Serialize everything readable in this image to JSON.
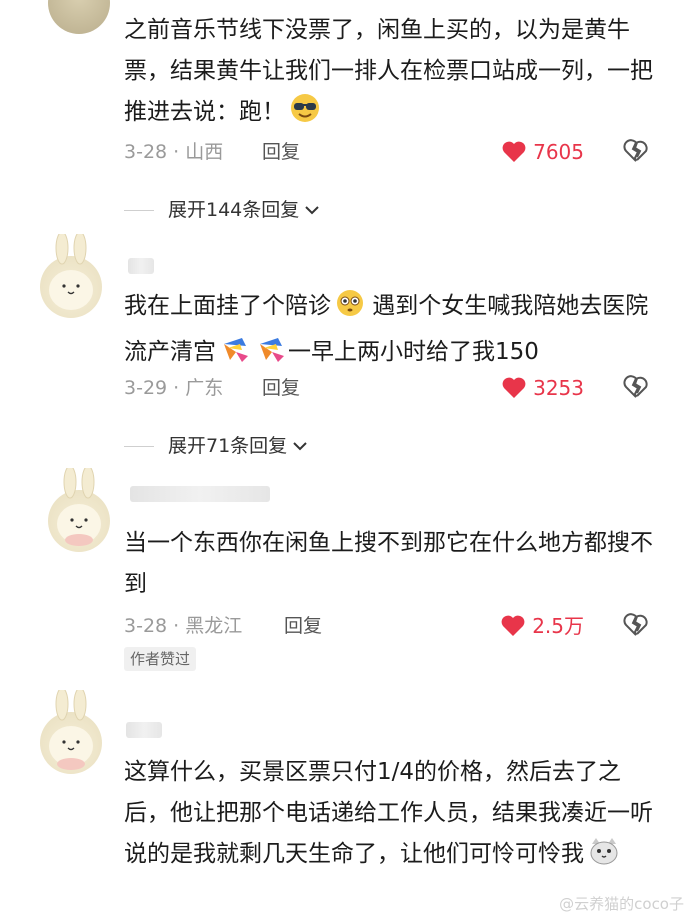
{
  "comments": [
    {
      "text": "之前音乐节线下没票了，闲鱼上买的，以为是黄牛票，结果黄牛让我们一排人在检票口站成一列，一把推进去说：跑！",
      "emoji": "sunglasses-face",
      "date": "3-28 · 山西",
      "reply": "回复",
      "likes": "7605",
      "expand": "展开144条回复"
    },
    {
      "text": "我在上面挂了个陪诊",
      "text2": " 遇到个女生喊我陪她去医院流产清宫",
      "text3": "一早上两小时给了我150",
      "date": "3-29 · 广东",
      "reply": "回复",
      "likes": "3253",
      "expand": "展开71条回复"
    },
    {
      "text": "当一个东西你在闲鱼上搜不到那它在什么地方都搜不到",
      "date": "3-28 · 黑龙江",
      "reply": "回复",
      "likes": "2.5万",
      "badge": "作者赞过"
    },
    {
      "text": "这算什么，买景区票只付1/4的价格，然后去了之后，他让把那个电话递给工作人员，结果我凑近一听说的是我就剩几天生命了，让他们可怜可怜我",
      "emoji": "cat-face"
    }
  ],
  "watermark": "@云养猫的coco子",
  "colors": {
    "like": "#e8354a",
    "meta": "#9a9a9a",
    "text": "#1c1c1c"
  }
}
